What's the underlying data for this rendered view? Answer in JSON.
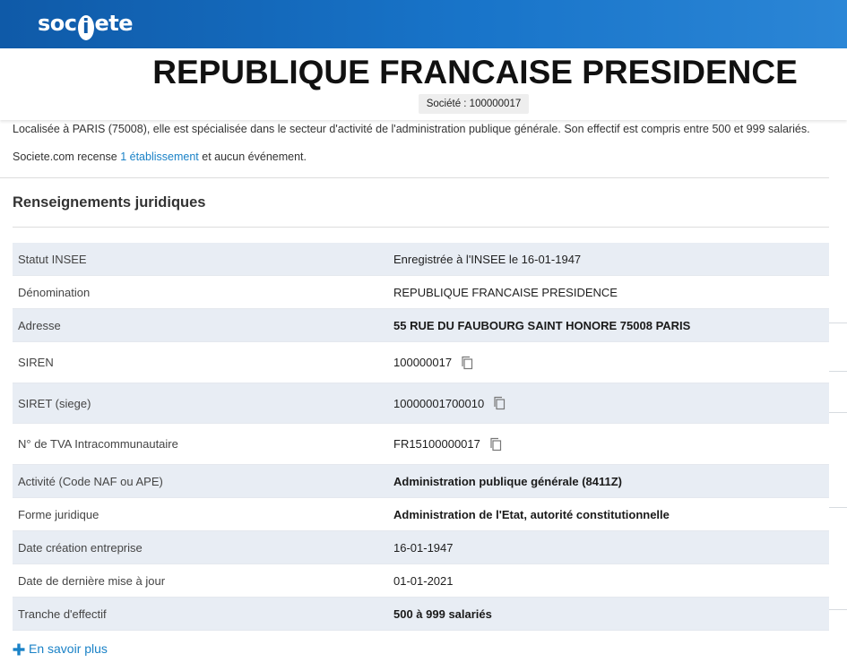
{
  "header": {
    "logo_part1": "soc",
    "logo_i": "i",
    "logo_part2": "ete",
    "brand_color": "#1874c9"
  },
  "company": {
    "title": "REPUBLIQUE FRANCAISE PRESIDENCE",
    "siren_badge": "Société : 100000017"
  },
  "intro": {
    "line1": "Localisée à PARIS (75008), elle est spécialisée dans le secteur d'activité de l'administration publique générale. Son effectif est compris entre 500 et 999 salariés.",
    "line2_prefix": "Societe.com recense ",
    "line2_link": "1 établissement",
    "line2_suffix": " et aucun événement."
  },
  "section": {
    "title": "Renseignements juridiques"
  },
  "rows": [
    {
      "label": "Statut INSEE",
      "value": "Enregistrée à l'INSEE le 16-01-1947"
    },
    {
      "label": "Dénomination",
      "value": "REPUBLIQUE FRANCAISE PRESIDENCE"
    },
    {
      "label": "Adresse",
      "value": "55 RUE DU FAUBOURG SAINT HONORE 75008 PARIS"
    },
    {
      "label": "SIREN",
      "value": "100000017",
      "icon": "copy-icon"
    },
    {
      "label": "SIRET (siege)",
      "value": "10000001700010",
      "icon": "copy-icon"
    },
    {
      "label": "N° de TVA Intracommunautaire",
      "value": "FR15100000017",
      "icon": "copy-icon"
    },
    {
      "label": "Activité (Code NAF ou APE)",
      "value": "Administration publique générale (8411Z)"
    },
    {
      "label": "Forme juridique",
      "value": "Administration de l'Etat, autorité constitutionnelle"
    },
    {
      "label": "Date création entreprise",
      "value": "16-01-1947"
    },
    {
      "label": "Date de dernière mise à jour",
      "value": "01-01-2021"
    },
    {
      "label": "Tranche d'effectif",
      "value": "500 à 999 salariés"
    }
  ],
  "more_link": {
    "label": "En savoir plus",
    "icon": "plus-icon"
  },
  "colors": {
    "link": "#1a82c7",
    "row_alt": "#e8edf4"
  }
}
